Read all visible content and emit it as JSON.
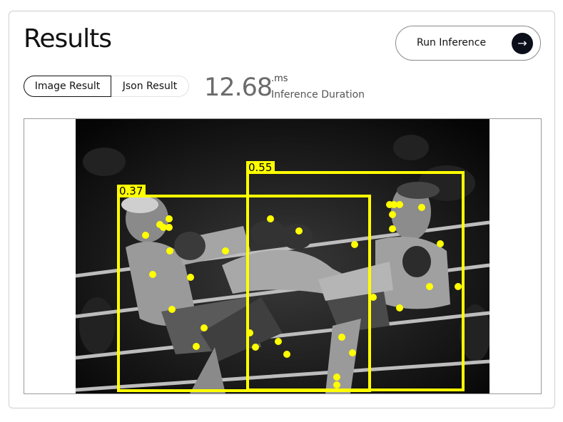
{
  "header": {
    "title": "Results"
  },
  "run_button": {
    "label": "Run Inference",
    "icon": "arrow-right-icon"
  },
  "tabs": [
    {
      "label": "Image Result",
      "active": true
    },
    {
      "label": "Json Result",
      "active": false
    }
  ],
  "inference": {
    "duration": "12.68",
    "unit": ".ms",
    "label": "Inference Duration"
  },
  "result_image": {
    "description_icon": "kickboxing-photo",
    "detections": [
      {
        "score": "0.37"
      },
      {
        "score": "0.55"
      }
    ],
    "box_color": "#ffff00",
    "keypoint_color": "#ffff00"
  },
  "colors": {
    "accent": "#ffff00",
    "button_icon_bg": "#0b0f1a"
  }
}
